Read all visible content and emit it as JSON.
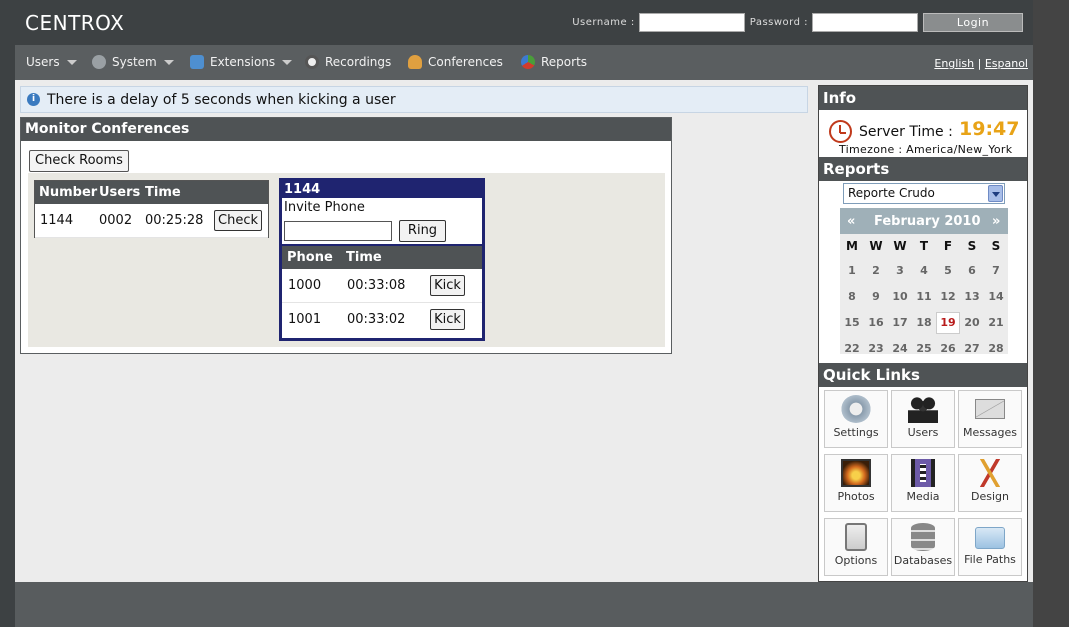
{
  "header": {
    "logo": "CENTROX",
    "username_label": "Username :",
    "password_label": "Password :",
    "login_label": "Login"
  },
  "nav": {
    "items": [
      "Users",
      "System",
      "Extensions",
      "Recordings",
      "Conferences",
      "Reports"
    ],
    "lang_en": "English",
    "lang_sep": "|",
    "lang_es": "Espanol"
  },
  "alert": {
    "text": "There is a delay of 5 seconds when kicking a user"
  },
  "monitor": {
    "title": "Monitor Conferences",
    "check_rooms_label": "Check Rooms",
    "rooms_headers": [
      "Number",
      "Users",
      "Time"
    ],
    "rooms": [
      {
        "number": "1144",
        "users": "0002",
        "time": "00:25:28",
        "action": "Check"
      }
    ],
    "conference": {
      "number": "1144",
      "invite_label": "Invite Phone",
      "ring_label": "Ring",
      "headers": [
        "Phone",
        "Time"
      ],
      "rows": [
        {
          "phone": "1000",
          "time": "00:33:08",
          "action": "Kick"
        },
        {
          "phone": "1001",
          "time": "00:33:02",
          "action": "Kick"
        }
      ]
    }
  },
  "info": {
    "title": "Info",
    "server_time_label": "Server Time :",
    "server_time": "19:47",
    "timezone": "Timezone : America/New_York"
  },
  "reports": {
    "title": "Reports",
    "selected": "Reporte Crudo",
    "calendar": {
      "prev": "«",
      "month": "February 2010",
      "next": "»",
      "dow": [
        "M",
        "W",
        "W",
        "T",
        "F",
        "S",
        "S"
      ],
      "weeks": [
        [
          "1",
          "2",
          "3",
          "4",
          "5",
          "6",
          "7"
        ],
        [
          "8",
          "9",
          "10",
          "11",
          "12",
          "13",
          "14"
        ],
        [
          "15",
          "16",
          "17",
          "18",
          "19",
          "20",
          "21"
        ],
        [
          "22",
          "23",
          "24",
          "25",
          "26",
          "27",
          "28"
        ]
      ],
      "today": "19"
    }
  },
  "quick_links": {
    "title": "Quick Links",
    "items": [
      "Settings",
      "Users",
      "Messages",
      "Photos",
      "Media",
      "Design",
      "Options",
      "Databases",
      "File Paths"
    ]
  },
  "colors": {
    "header": "#3d4143",
    "nav": "#5a5e60",
    "accent_time": "#e8a317",
    "conf_border": "#1f2470"
  }
}
